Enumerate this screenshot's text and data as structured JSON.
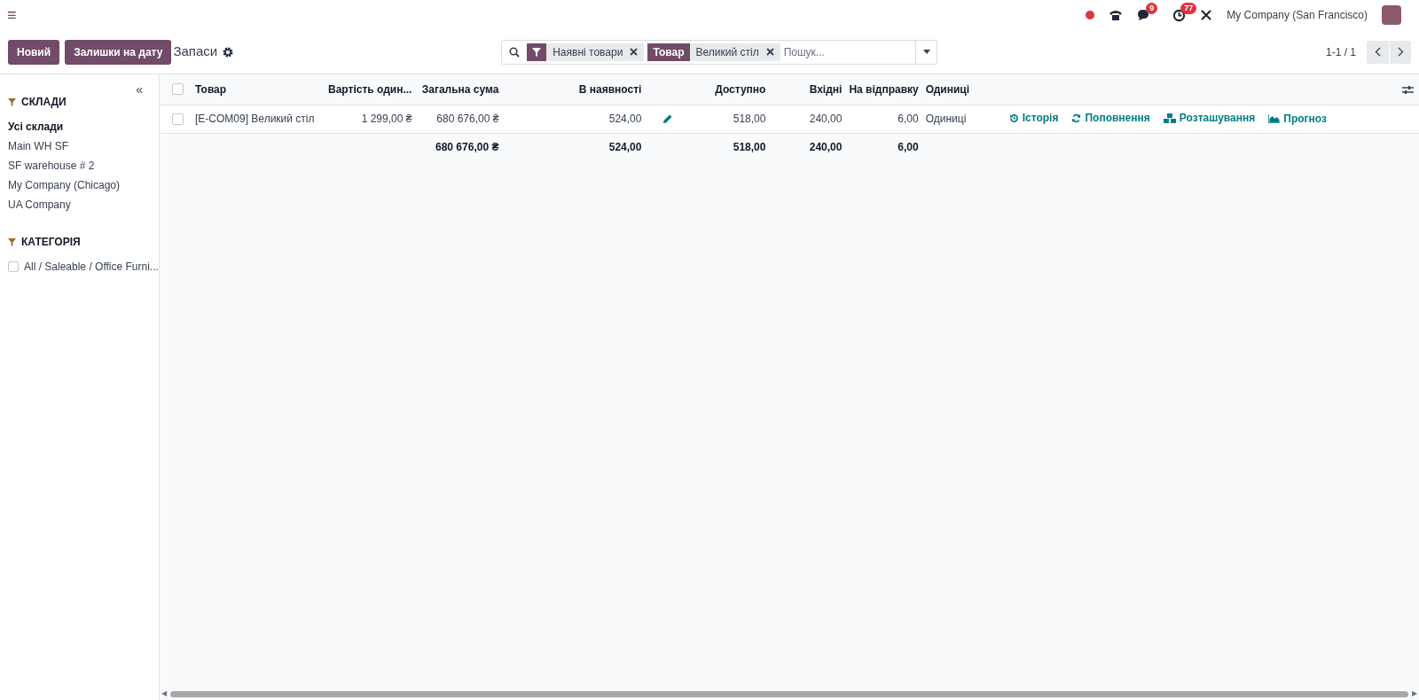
{
  "topbar": {
    "menu_icon": "≡",
    "company": "My Company (San Francisco)",
    "messages_count": "9",
    "activities_count": "77"
  },
  "control_panel": {
    "buttons": [
      "Новий",
      "Залишки на дату"
    ],
    "title": "Запаси"
  },
  "search": {
    "facets": [
      {
        "kind": "filter",
        "values": [
          "Наявні товари"
        ]
      },
      {
        "kind": "field",
        "label": "Товар",
        "values": [
          "Великий стіл"
        ]
      }
    ],
    "placeholder": "Пошук..."
  },
  "pager": {
    "value": "1-1 / 1"
  },
  "sidebar": {
    "collapse": "«",
    "sections": [
      {
        "title": "СКЛАДИ",
        "kind": "radio",
        "items": [
          {
            "label": "Усі склади",
            "selected": true
          },
          {
            "label": "Main WH SF",
            "selected": false
          },
          {
            "label": "SF warehouse # 2",
            "selected": false
          },
          {
            "label": "My Company (Chicago)",
            "selected": false
          },
          {
            "label": "UA Company",
            "selected": false
          }
        ]
      },
      {
        "title": "КАТЕГОРІЯ",
        "kind": "checkbox",
        "items": [
          {
            "label": "All / Saleable / Office Furni...",
            "checked": false
          }
        ]
      }
    ]
  },
  "table": {
    "columns": [
      "Товар",
      "Вартість один...",
      "Загальна сума",
      "В наявності",
      "Доступно",
      "Вхідні",
      "На відправку",
      "Одиниці"
    ],
    "rows": [
      {
        "selected": false,
        "cells": [
          "[E-COM09] Великий стіл",
          "1 299,00 ₴",
          "680 676,00 ₴",
          "524,00",
          "518,00",
          "240,00",
          "6,00",
          "Одиниці"
        ],
        "actions": [
          {
            "kind": "history",
            "label": "Історія"
          },
          {
            "kind": "replenish",
            "label": "Поповнення"
          },
          {
            "kind": "locations",
            "label": "Розташування"
          },
          {
            "kind": "forecast",
            "label": "Прогноз"
          }
        ]
      }
    ],
    "totals": [
      "680 676,00 ₴",
      "524,00",
      "518,00",
      "240,00",
      "6,00"
    ],
    "all_selected": false
  },
  "scrollbar": {
    "left_arrow": "◀",
    "right_arrow": "▶"
  }
}
